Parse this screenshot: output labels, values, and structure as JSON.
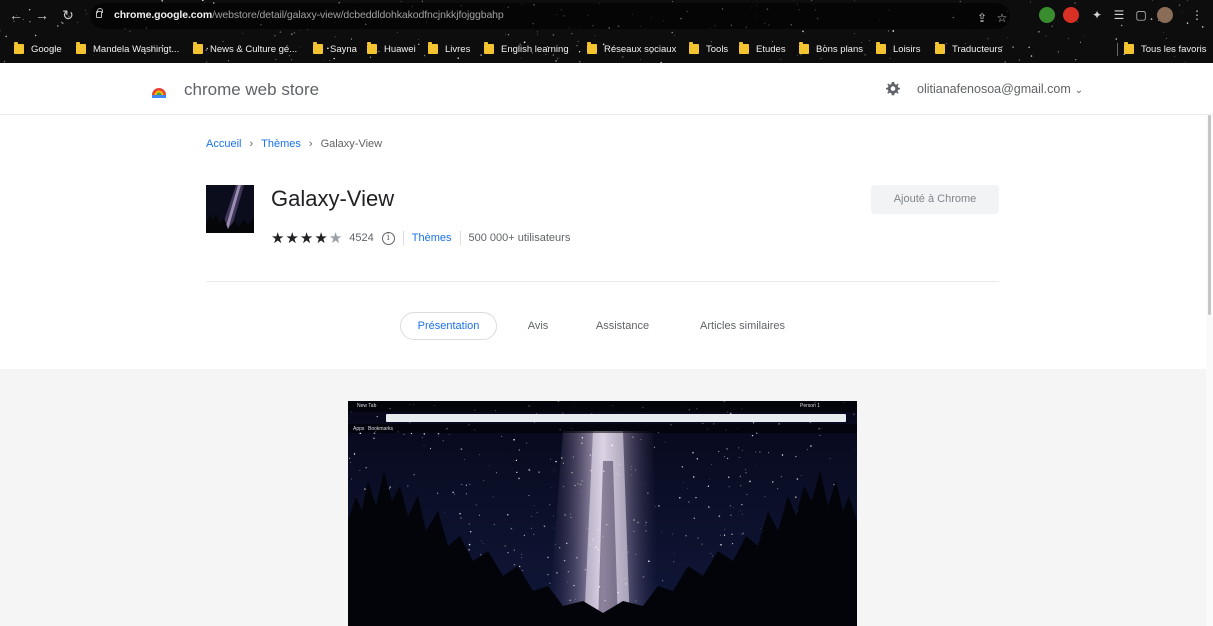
{
  "browser": {
    "url_host": "chrome.google.com",
    "url_path": "/webstore/detail/galaxy-view/dcbeddldohkakodfncjnkkjfojggbahp",
    "icons": [
      "back-icon",
      "forward-icon",
      "reload-icon",
      "lock-icon",
      "share-icon",
      "star-icon",
      "extension-icons",
      "puzzle-icon",
      "reading-list-icon",
      "sidepanel-icon",
      "profile-avatar",
      "menu-icon"
    ]
  },
  "bookmarks": {
    "items": [
      {
        "label": "Google"
      },
      {
        "label": "Mandela Washingt..."
      },
      {
        "label": "News & Culture gé..."
      },
      {
        "label": "Sayna"
      },
      {
        "label": "Huawei"
      },
      {
        "label": "Livres"
      },
      {
        "label": "English learning"
      },
      {
        "label": "Réseaux sociaux"
      },
      {
        "label": "Tools"
      },
      {
        "label": "Etudes"
      },
      {
        "label": "Bons plans"
      },
      {
        "label": "Loisirs"
      },
      {
        "label": "Traducteurs"
      }
    ],
    "all_bookmarks": "Tous les favoris"
  },
  "store": {
    "title": "chrome web store",
    "account": "olitianafenosoa@gmail.com",
    "accent": "#1a73e8"
  },
  "breadcrumb": {
    "home": "Accueil",
    "category": "Thèmes",
    "current": "Galaxy-View",
    "separator": "›"
  },
  "item": {
    "title": "Galaxy-View",
    "rating": 4.5,
    "rating_count": "4524",
    "category": "Thèmes",
    "users": "500 000+ utilisateurs",
    "action_button": "Ajouté à Chrome"
  },
  "tabs": [
    {
      "label": "Présentation",
      "active": true
    },
    {
      "label": "Avis",
      "active": false
    },
    {
      "label": "Assistance",
      "active": false
    },
    {
      "label": "Articles similaires",
      "active": false
    }
  ],
  "screenshot": {
    "tab_label": "New Tab",
    "profile_label": "Person 1",
    "apps_label": "Apps",
    "bookmarks_label": "Bookmarks"
  }
}
